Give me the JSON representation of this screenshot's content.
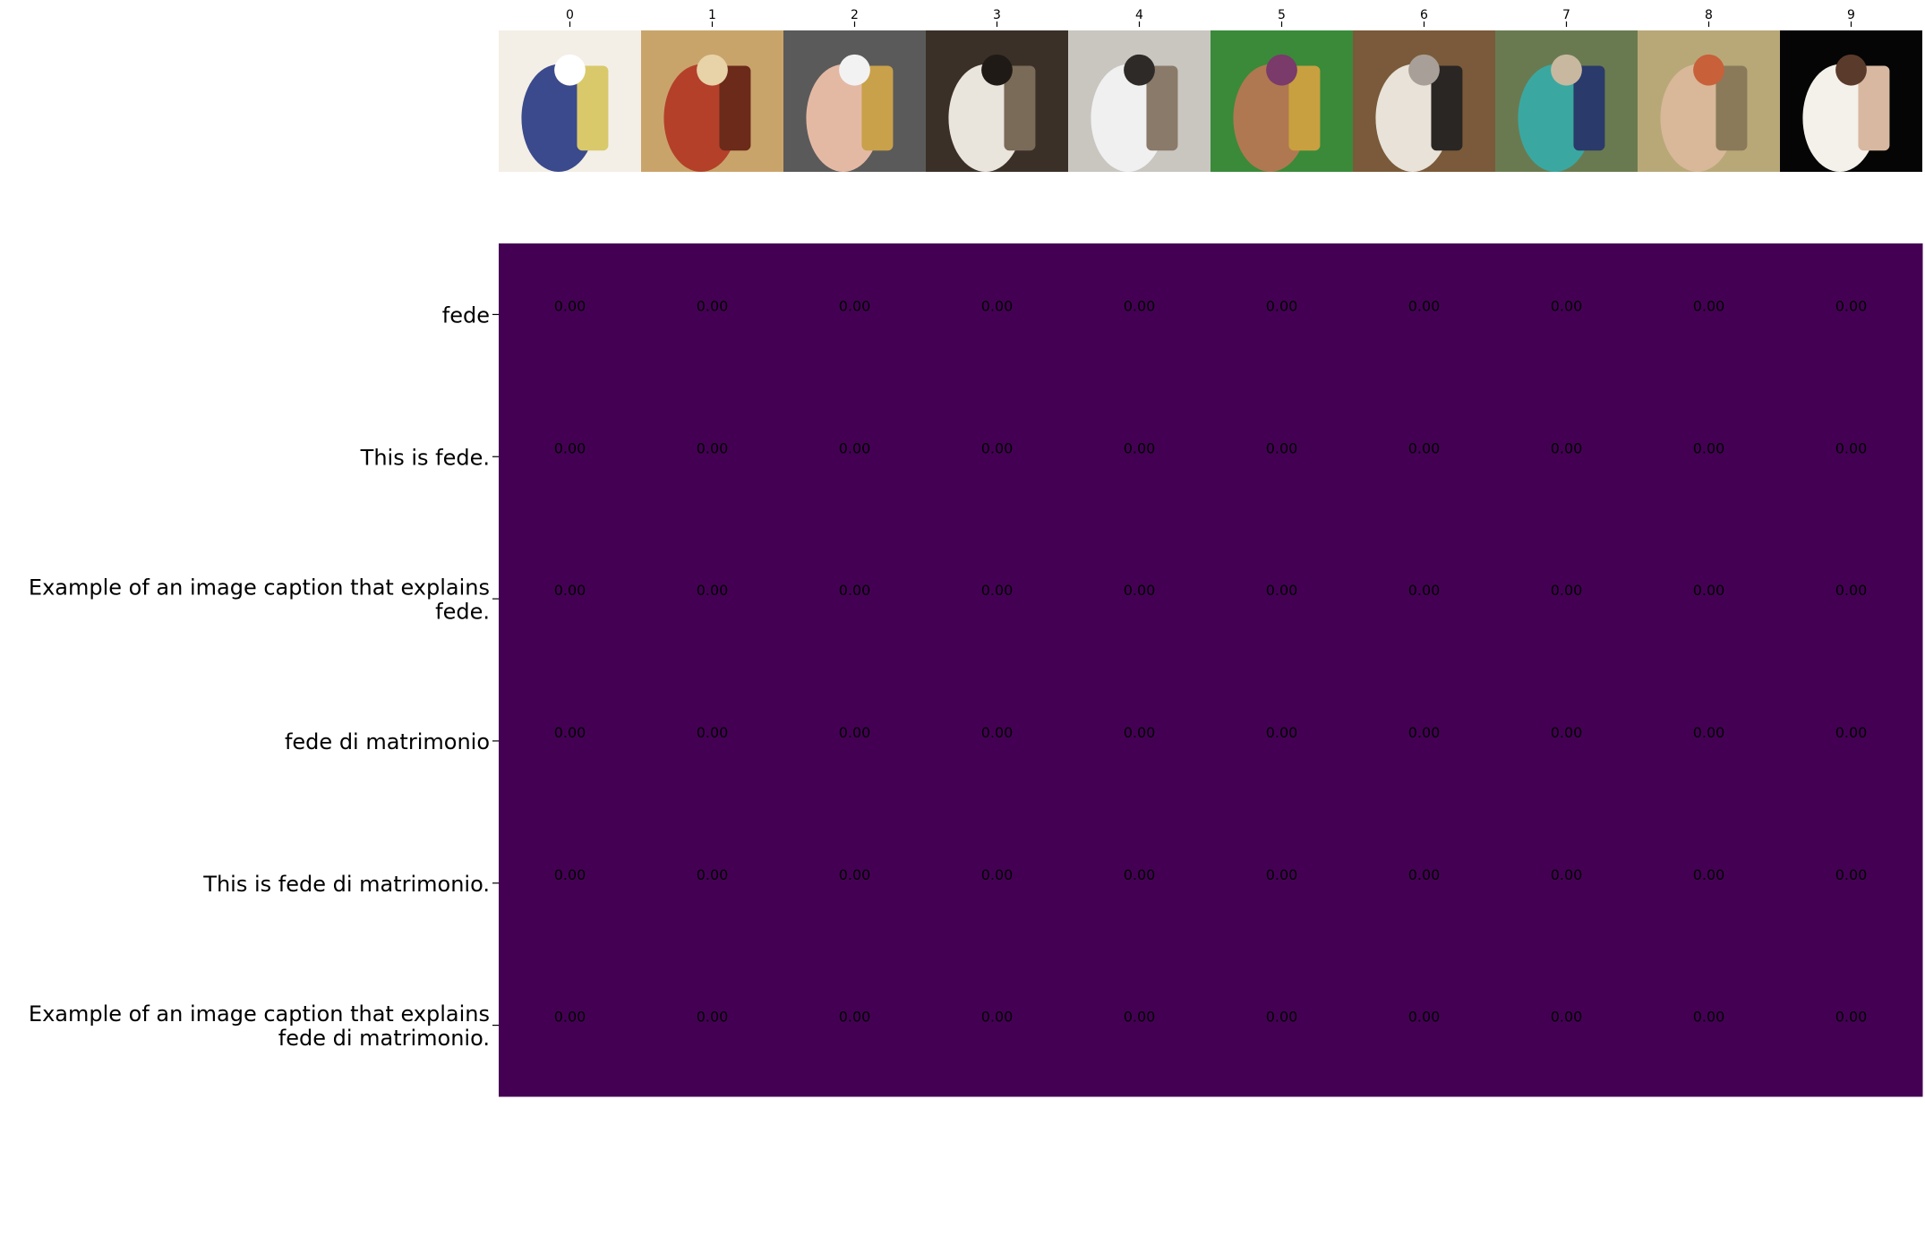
{
  "chart_data": {
    "type": "heatmap",
    "title": "",
    "xlabel": "",
    "ylabel": "",
    "x_tick_labels": [
      "0",
      "1",
      "2",
      "3",
      "4",
      "5",
      "6",
      "7",
      "8",
      "9"
    ],
    "y_tick_labels": [
      [
        "fede"
      ],
      [
        "This is fede."
      ],
      [
        "Example of an image caption that explains",
        "fede."
      ],
      [
        "fede di matrimonio"
      ],
      [
        "This is fede di matrimonio."
      ],
      [
        "Example of an image caption that explains",
        "fede di matrimonio."
      ]
    ],
    "values": [
      [
        0.0,
        0.0,
        0.0,
        0.0,
        0.0,
        0.0,
        0.0,
        0.0,
        0.0,
        0.0
      ],
      [
        0.0,
        0.0,
        0.0,
        0.0,
        0.0,
        0.0,
        0.0,
        0.0,
        0.0,
        0.0
      ],
      [
        0.0,
        0.0,
        0.0,
        0.0,
        0.0,
        0.0,
        0.0,
        0.0,
        0.0,
        0.0
      ],
      [
        0.0,
        0.0,
        0.0,
        0.0,
        0.0,
        0.0,
        0.0,
        0.0,
        0.0,
        0.0
      ],
      [
        0.0,
        0.0,
        0.0,
        0.0,
        0.0,
        0.0,
        0.0,
        0.0,
        0.0,
        0.0
      ],
      [
        0.0,
        0.0,
        0.0,
        0.0,
        0.0,
        0.0,
        0.0,
        0.0,
        0.0,
        0.0
      ]
    ],
    "value_format": "0.00",
    "colormap": "viridis",
    "cell_color": "#440154",
    "annotation_color": "#000000",
    "x_axis_position": "top",
    "grid": false,
    "legend": "none"
  },
  "thumbnails": [
    {
      "name": "caricature-couple-image",
      "colors": [
        "#f3efe6",
        "#3b4a8c",
        "#d9c96a",
        "#ffffff"
      ]
    },
    {
      "name": "saint-painting-image",
      "colors": [
        "#c9a46a",
        "#b4402a",
        "#6b2a1a",
        "#e8d2a8"
      ]
    },
    {
      "name": "ring-on-finger-image",
      "colors": [
        "#5a5a5a",
        "#e4b9a4",
        "#c9a14a",
        "#f2f2f2"
      ]
    },
    {
      "name": "wedding-ceremony-image",
      "colors": [
        "#3a3028",
        "#e9e4dc",
        "#7a6a58",
        "#1f1a16"
      ]
    },
    {
      "name": "clergy-procession-image",
      "colors": [
        "#c9c6c0",
        "#f0f0f0",
        "#8a7a6a",
        "#2d2a28"
      ]
    },
    {
      "name": "neck-rings-woman-image",
      "colors": [
        "#3a8a3a",
        "#b07850",
        "#c8a040",
        "#7a3a6a"
      ]
    },
    {
      "name": "wedding-hall-image",
      "colors": [
        "#7a5a3a",
        "#e8e2d8",
        "#2a2624",
        "#a8a098"
      ]
    },
    {
      "name": "couple-outdoors-image",
      "colors": [
        "#6a7a50",
        "#3aa8a0",
        "#2a3a6a",
        "#c8b8a0"
      ]
    },
    {
      "name": "creation-fresco-image",
      "colors": [
        "#b8a878",
        "#d8b898",
        "#8a7a5a",
        "#c8603a"
      ]
    },
    {
      "name": "bride-bouquet-image",
      "colors": [
        "#050505",
        "#f4f1ea",
        "#d8b8a0",
        "#5a3a2a"
      ]
    }
  ]
}
